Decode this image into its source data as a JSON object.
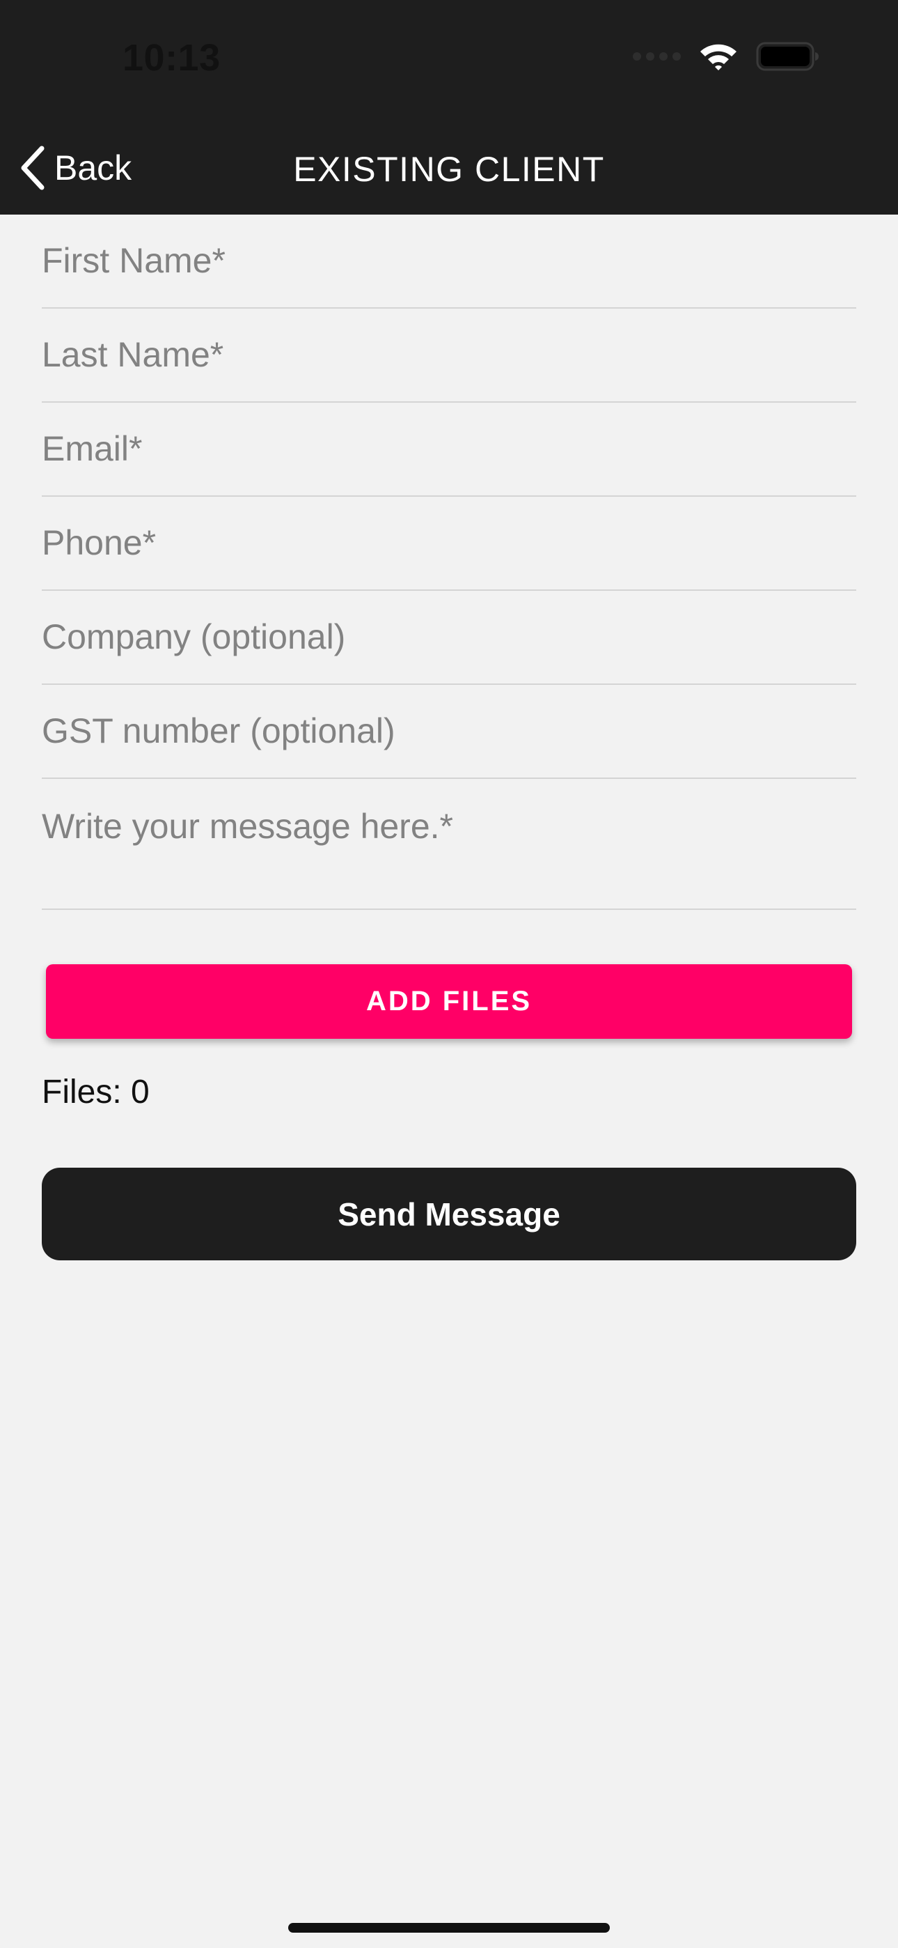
{
  "status_bar": {
    "time": "10:13"
  },
  "nav": {
    "back_label": "Back",
    "title": "EXISTING CLIENT"
  },
  "form": {
    "fields": [
      {
        "placeholder": "First Name*",
        "value": ""
      },
      {
        "placeholder": "Last Name*",
        "value": ""
      },
      {
        "placeholder": "Email*",
        "value": ""
      },
      {
        "placeholder": "Phone*",
        "value": ""
      },
      {
        "placeholder": "Company (optional)",
        "value": ""
      },
      {
        "placeholder": "GST number (optional)",
        "value": ""
      }
    ],
    "message": {
      "placeholder": "Write your message here.*",
      "value": ""
    }
  },
  "actions": {
    "add_files_label": "ADD FILES",
    "files_count_text": "Files: 0",
    "send_label": "Send Message"
  },
  "colors": {
    "header_bg": "#1e1e1e",
    "page_bg": "#f2f2f2",
    "accent": "#ff0066",
    "send_button_bg": "#1e1e1e"
  },
  "icons": {
    "back": "chevron-left-icon",
    "wifi": "wifi-icon",
    "battery": "battery-icon",
    "signal": "cellular-signal-icon"
  }
}
